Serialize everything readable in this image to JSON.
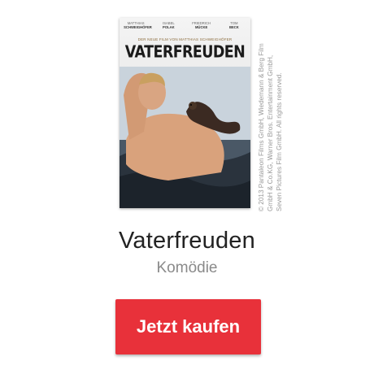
{
  "poster": {
    "cast": [
      {
        "first": "MATTHIAS",
        "last": "SCHWEIGHÖFER"
      },
      {
        "first": "ISABEL",
        "last": "POLAK"
      },
      {
        "first": "FRIEDRICH",
        "last": "MÜCKE"
      },
      {
        "first": "TOM",
        "last": "BECK"
      }
    ],
    "tagline": "DER NEUE FILM VON MATTHIAS SCHWEIGHÖFER",
    "title": "VATERFREUDEN"
  },
  "copyright": {
    "line1": "© 2013 Pantaleon Films GmbH, Wiedemann & Berg Film",
    "line2": "GmbH & Co.KG, Warner Bros. Entertainment GmbH,",
    "line3": "Seven Pictures Film GmbH. All rights reserved."
  },
  "movie": {
    "title": "Vaterfreuden",
    "genre": "Komödie"
  },
  "buy_button": {
    "label": "Jetzt kaufen",
    "color": "#e8313a"
  }
}
